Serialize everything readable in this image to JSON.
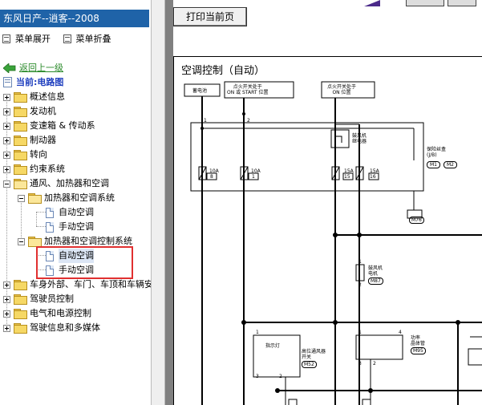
{
  "sidebar": {
    "title": "东风日产--逍客--2008",
    "actions": {
      "expand": "菜单展开",
      "collapse": "菜单折叠"
    },
    "back": "返回上一级",
    "current": "当前:电路图",
    "items": [
      "概述信息",
      "发动机",
      "变速箱 & 传动系",
      "制动器",
      "转向",
      "约束系统",
      "通风、加热器和空调",
      "加热器和空调系统",
      "自动空调",
      "手动空调",
      "加热器和空调控制系统",
      "自动空调",
      "手动空调",
      "车身外部、车门、车顶和车辆安",
      "驾驶员控制",
      "电气和电源控制",
      "驾驶信息和多媒体"
    ]
  },
  "toolbar": {
    "print": "打印当前页"
  },
  "diagram": {
    "title": "空调控制（自动）",
    "labels": {
      "battery": "蓄电池",
      "ign_on_start": "点火开关处于\nON 或 START 位置",
      "ign_on": "点火开关处于\nON 位置",
      "fuse_10a_1": "10A",
      "fuse_10a_1_num": "8",
      "fuse_10a_2": "10A",
      "fuse_10a_2_num": "1",
      "fuse_15a_1": "15A",
      "fuse_15a_1_num": "15",
      "fuse_15a_2": "15A",
      "fuse_15a_2_num": "16",
      "blower_relay": "鼓风机\n继电器",
      "fuse_box": "保险丝盒\n(J/B)",
      "m1": "M1",
      "m2": "M2",
      "m76": "M76",
      "blower_motor": "鼓风机\n电机",
      "m87": "M87",
      "indicator": "指示灯",
      "hi_blower_sw": "高位通风器\n开关",
      "m52": "M52",
      "power_transistor": "功率\n晶体管",
      "m95": "M95",
      "wire_1": "1",
      "wire_2": "2",
      "pin_1a": "1",
      "pin_3a": "3",
      "pin_2a": "2",
      "pin_1b": "1",
      "pin_4b": "4",
      "pin_3b": "3",
      "pin_2b": "2",
      "pin_1c": "1",
      "pin_2c": "2"
    }
  },
  "colors": {
    "title_bar": "#1f63a8",
    "highlight": "#e03030",
    "link": "#2a8a2a"
  }
}
